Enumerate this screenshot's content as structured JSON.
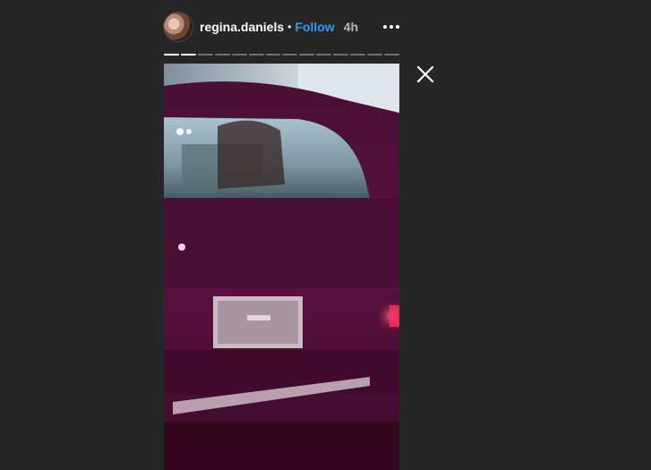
{
  "story": {
    "username": "regina.daniels",
    "separator": "•",
    "follow_label": "Follow",
    "timestamp": "4h",
    "segments_total": 14,
    "segments_viewed": 2
  },
  "icons": {
    "more": "more-horizontal-icon",
    "close": "close-icon",
    "avatar": "profile-avatar"
  },
  "colors": {
    "background": "#262626",
    "follow": "#3897f0",
    "media_tint": "#5a1240"
  }
}
